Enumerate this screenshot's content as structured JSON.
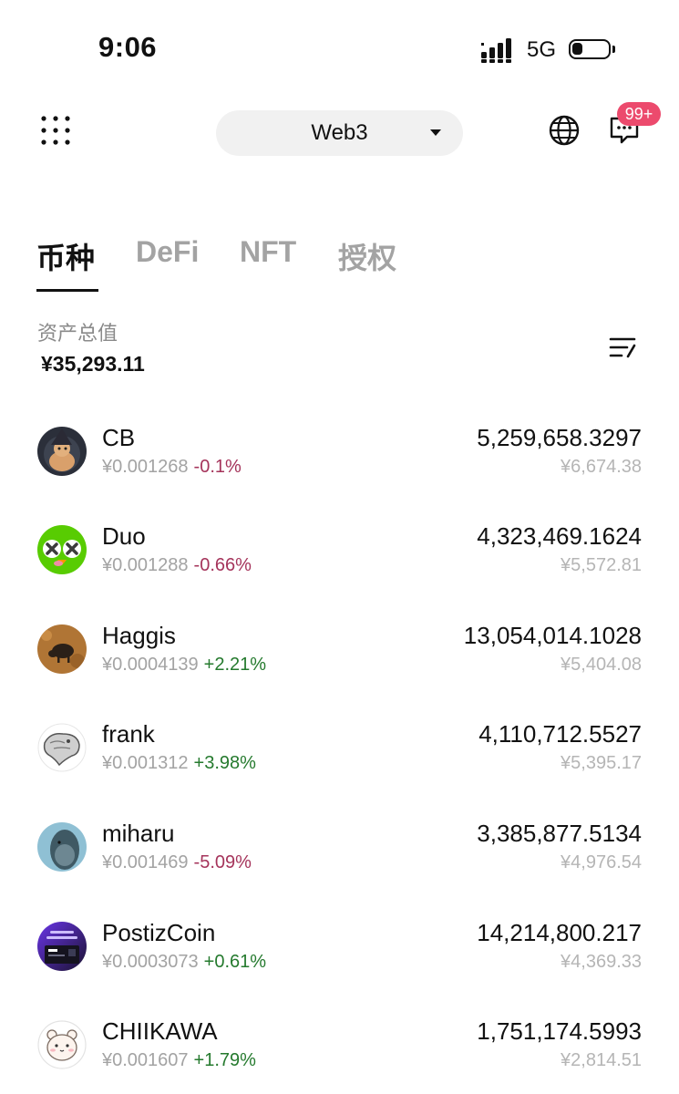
{
  "status_bar": {
    "time": "9:06",
    "network": "5G",
    "icons": [
      "signal-icon",
      "battery-icon"
    ]
  },
  "header": {
    "network_selector": "Web3",
    "notification_badge": "99+",
    "icons": [
      "grid-menu-icon",
      "chevron-down-icon",
      "globe-icon",
      "chat-icon"
    ]
  },
  "tabs": [
    {
      "label": "币种",
      "active": true
    },
    {
      "label": "DeFi",
      "active": false
    },
    {
      "label": "NFT",
      "active": false
    },
    {
      "label": "授权",
      "active": false
    }
  ],
  "summary": {
    "total_label": "资产总值",
    "total_value": "¥35,293.11",
    "sort_icon": "sort-list-icon"
  },
  "colors": {
    "negative": "#a5345b",
    "positive": "#257a2e",
    "badge": "#ec4a6d",
    "muted": "#a3a3a3",
    "pill_bg": "#f1f1f1"
  },
  "tokens": [
    {
      "name": "CB",
      "price": "¥0.001268",
      "change": "-0.1%",
      "direction": "down",
      "amount": "5,259,658.3297",
      "value": "¥6,674.38",
      "avatar": "wizard-avatar-icon"
    },
    {
      "name": "Duo",
      "price": "¥0.001288",
      "change": "-0.66%",
      "direction": "down",
      "amount": "4,323,469.1624",
      "value": "¥5,572.81",
      "avatar": "owl-avatar-icon"
    },
    {
      "name": "Haggis",
      "price": "¥0.0004139",
      "change": "+2.21%",
      "direction": "up",
      "amount": "13,054,014.1028",
      "value": "¥5,404.08",
      "avatar": "boar-avatar-icon"
    },
    {
      "name": "frank",
      "price": "¥0.001312",
      "change": "+3.98%",
      "direction": "up",
      "amount": "4,110,712.5527",
      "value": "¥5,395.17",
      "avatar": "sculpture-avatar-icon"
    },
    {
      "name": "miharu",
      "price": "¥0.001469",
      "change": "-5.09%",
      "direction": "down",
      "amount": "3,385,877.5134",
      "value": "¥4,976.54",
      "avatar": "fish-avatar-icon"
    },
    {
      "name": "PostizCoin",
      "price": "¥0.0003073",
      "change": "+0.61%",
      "direction": "up",
      "amount": "14,214,800.217",
      "value": "¥4,369.33",
      "avatar": "app-avatar-icon"
    },
    {
      "name": "CHIIKAWA",
      "price": "¥0.001607",
      "change": "+1.79%",
      "direction": "up",
      "amount": "1,751,174.5993",
      "value": "¥2,814.51",
      "avatar": "bear-avatar-icon"
    }
  ]
}
